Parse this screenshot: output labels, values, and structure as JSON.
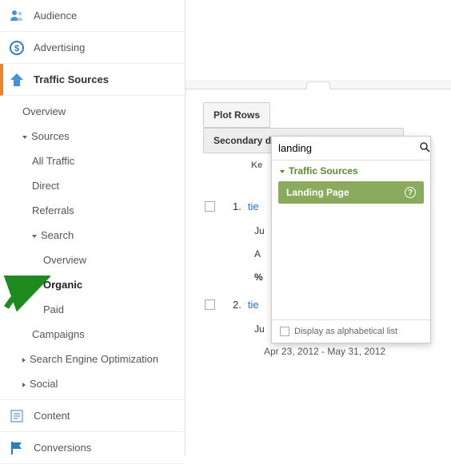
{
  "sidebar": {
    "top": [
      {
        "label": "Audience",
        "icon": "audience"
      },
      {
        "label": "Advertising",
        "icon": "advertising"
      },
      {
        "label": "Traffic Sources",
        "icon": "traffic",
        "active": true
      }
    ],
    "sub": [
      {
        "label": "Overview",
        "level": 1,
        "expand": ""
      },
      {
        "label": "Sources",
        "level": 1,
        "expand": "caret"
      },
      {
        "label": "All Traffic",
        "level": 2,
        "expand": ""
      },
      {
        "label": "Direct",
        "level": 2,
        "expand": ""
      },
      {
        "label": "Referrals",
        "level": 2,
        "expand": ""
      },
      {
        "label": "Search",
        "level": 2,
        "expand": "caret"
      },
      {
        "label": "Overview",
        "level": 3,
        "expand": ""
      },
      {
        "label": "Organic",
        "level": 3,
        "expand": "",
        "sel": true
      },
      {
        "label": "Paid",
        "level": 3,
        "expand": ""
      },
      {
        "label": "Campaigns",
        "level": 2,
        "expand": ""
      },
      {
        "label": "Search Engine Optimization",
        "level": 1,
        "expand": "caret-r"
      },
      {
        "label": "Social",
        "level": 1,
        "expand": "caret-r"
      }
    ],
    "bottom": [
      {
        "label": "Content",
        "icon": "content"
      },
      {
        "label": "Conversions",
        "icon": "flag"
      }
    ]
  },
  "toolbar": {
    "plot_rows": "Plot Rows",
    "secondary_dim": "Secondary dimension: Landing Page"
  },
  "column_label": "Ke",
  "rows": [
    {
      "num": "1.",
      "link": "tie"
    },
    {
      "num": "2.",
      "link": "tie"
    }
  ],
  "metrics": {
    "m1": "Ju",
    "m2": "A",
    "m3": "%",
    "m4": "Ju"
  },
  "date_range": "Apr 23, 2012 - May 31, 2012",
  "dropdown": {
    "search_value": "landing",
    "category": "Traffic Sources",
    "item": "Landing Page",
    "footer": "Display as alphabetical list"
  }
}
